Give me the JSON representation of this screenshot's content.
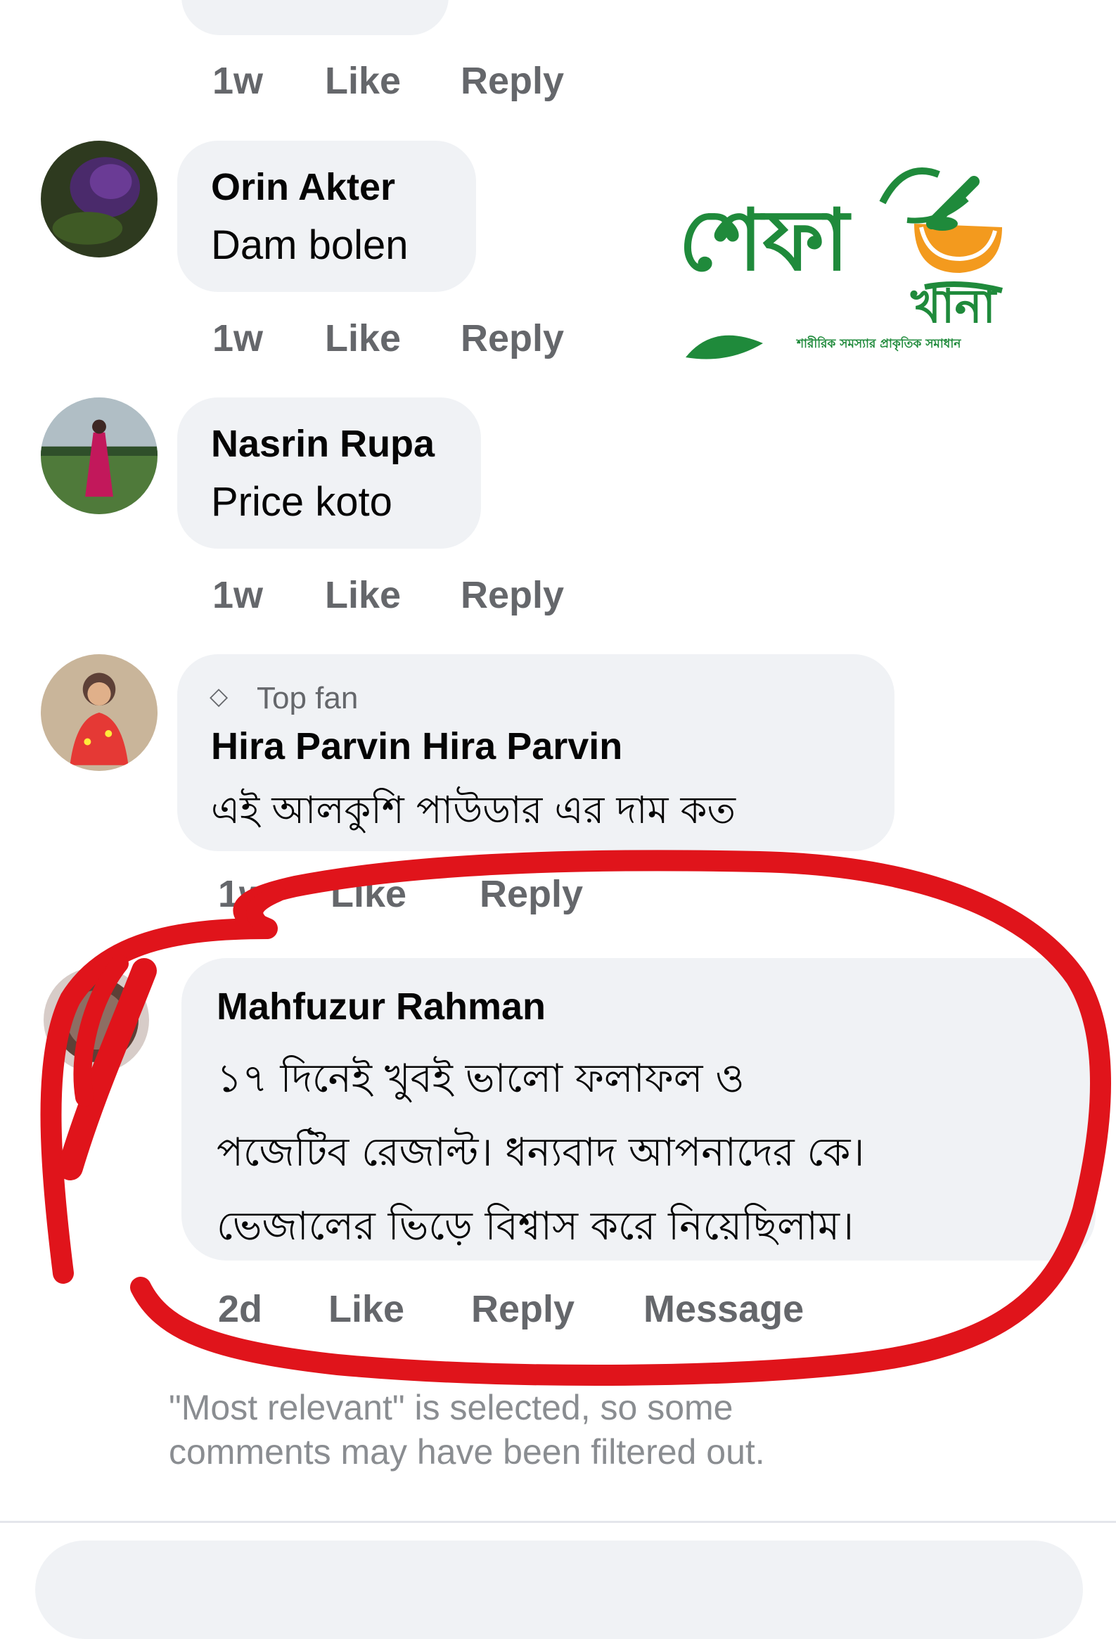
{
  "top_actions": {
    "time": "1w",
    "like": "Like",
    "reply": "Reply"
  },
  "comments": [
    {
      "name": "Orin Akter",
      "text": "Dam bolen",
      "time": "1w",
      "like": "Like",
      "reply": "Reply"
    },
    {
      "name": "Nasrin Rupa",
      "text": "Price koto",
      "time": "1w",
      "like": "Like",
      "reply": "Reply"
    },
    {
      "badge": "Top fan",
      "name": "Hira Parvin Hira Parvin",
      "text": "এই আলকুশি পাউডার এর দাম কত",
      "time": "1w",
      "like": "Like",
      "reply": "Reply"
    },
    {
      "name": "Mahfuzur Rahman",
      "lines": [
        "১৭ দিনেই খুবই ভালো ফলাফল ও",
        "পজেটিব রেজাল্ট। ধন্যবাদ আপনাদের কে।",
        "ভেজালের ভিড়ে বিশ্বাস করে নিয়েছিলাম।"
      ],
      "time": "2d",
      "like": "Like",
      "reply": "Reply",
      "message": "Message"
    }
  ],
  "filter_notice": {
    "line1": "\"Most relevant\" is selected, so some",
    "line2": "comments may have been filtered out."
  },
  "logo": {
    "title": "শেফা",
    "subtitle": "খানা",
    "tagline": "শারীরিক সমস্যার প্রাকৃতিক সমাধান"
  },
  "colors": {
    "logo_green": "#1f8a3b",
    "logo_orange": "#f39a1e",
    "highlight_red": "#e0141b",
    "bubble_bg": "#f0f2f5",
    "meta_gray": "#65676b"
  }
}
